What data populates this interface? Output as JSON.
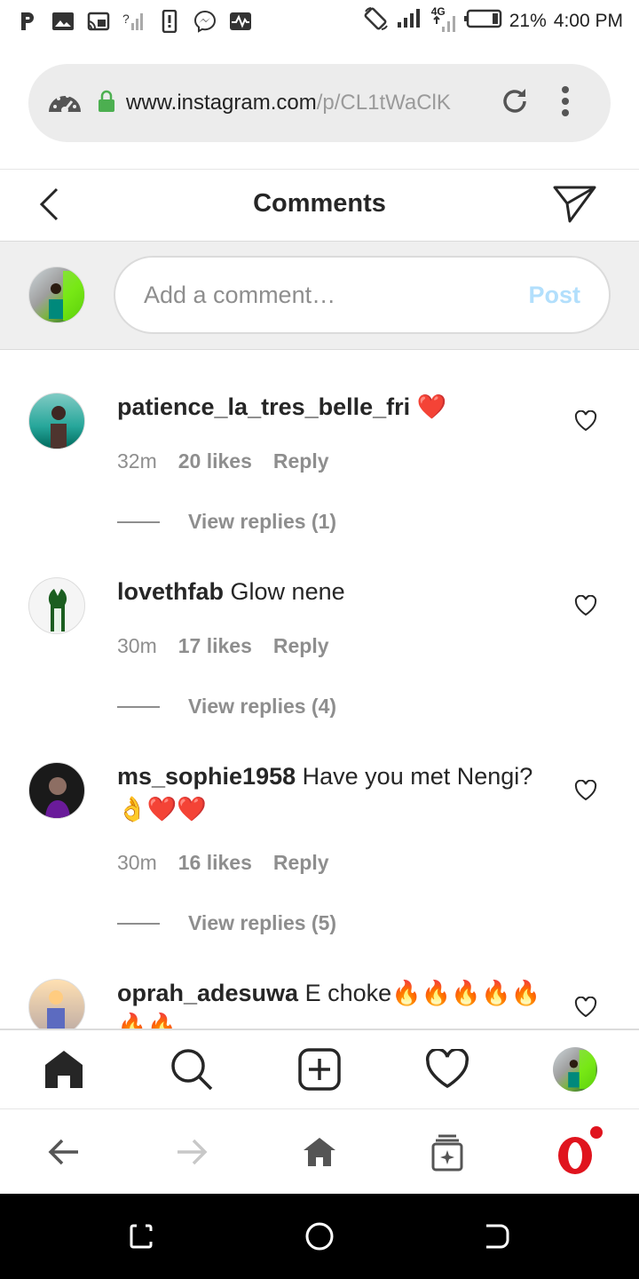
{
  "status_bar": {
    "battery": "21%",
    "time": "4:00 PM",
    "network": "4G",
    "left_icons": [
      "p-icon",
      "photo-icon",
      "cast-icon",
      "signal-question-icon",
      "phone-icon",
      "messenger-icon",
      "activity-icon"
    ]
  },
  "browser": {
    "url_host": "www.instagram.com",
    "url_path": "/p/CL1tWaClK"
  },
  "header": {
    "title": "Comments"
  },
  "add_comment": {
    "placeholder": "Add a comment…",
    "post_label": "Post"
  },
  "comments": [
    {
      "username": "patience_la_tres_belle_fri",
      "text": "❤️",
      "time": "32m",
      "likes": "20 likes",
      "reply": "Reply",
      "view_replies": "View replies (1)"
    },
    {
      "username": "lovethfab",
      "text": "Glow nene",
      "time": "30m",
      "likes": "17 likes",
      "reply": "Reply",
      "view_replies": "View replies (4)"
    },
    {
      "username": "ms_sophie1958",
      "text": "Have you met Nengi? 👌❤️❤️",
      "time": "30m",
      "likes": "16 likes",
      "reply": "Reply",
      "view_replies": "View replies (5)"
    },
    {
      "username": "oprah_adesuwa",
      "text": "E choke🔥🔥🔥🔥🔥🔥🔥"
    }
  ],
  "colors": {
    "post_disabled": "#b2dffc",
    "meta_gray": "#8e8e8e",
    "opera_red": "#e0141e"
  }
}
